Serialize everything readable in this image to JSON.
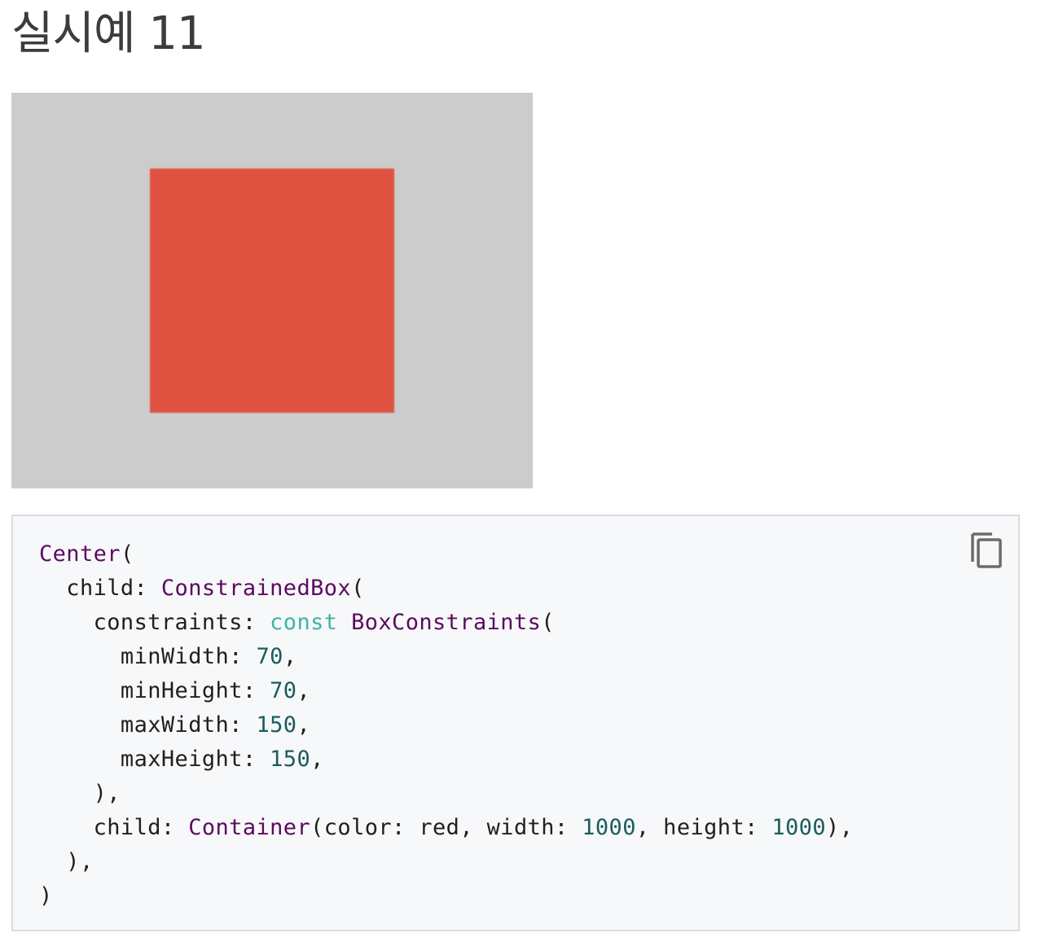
{
  "heading": "실시예 11",
  "colors": {
    "preview_background": "#cccccc",
    "box_color": "#e05340",
    "code_background": "#f7f8fa",
    "type_color": "#5b0b5e",
    "keyword_color": "#3fb4a5",
    "number_color": "#1a5d5d"
  },
  "copy_button": {
    "icon": "copy-icon"
  },
  "code": {
    "lines": [
      [
        {
          "t": "type",
          "v": "Center"
        },
        {
          "t": "plain",
          "v": "("
        }
      ],
      [
        {
          "t": "plain",
          "v": "  child: "
        },
        {
          "t": "type",
          "v": "ConstrainedBox"
        },
        {
          "t": "plain",
          "v": "("
        }
      ],
      [
        {
          "t": "plain",
          "v": "    constraints: "
        },
        {
          "t": "kw",
          "v": "const"
        },
        {
          "t": "plain",
          "v": " "
        },
        {
          "t": "type",
          "v": "BoxConstraints"
        },
        {
          "t": "plain",
          "v": "("
        }
      ],
      [
        {
          "t": "plain",
          "v": "      minWidth: "
        },
        {
          "t": "num",
          "v": "70"
        },
        {
          "t": "plain",
          "v": ","
        }
      ],
      [
        {
          "t": "plain",
          "v": "      minHeight: "
        },
        {
          "t": "num",
          "v": "70"
        },
        {
          "t": "plain",
          "v": ","
        }
      ],
      [
        {
          "t": "plain",
          "v": "      maxWidth: "
        },
        {
          "t": "num",
          "v": "150"
        },
        {
          "t": "plain",
          "v": ","
        }
      ],
      [
        {
          "t": "plain",
          "v": "      maxHeight: "
        },
        {
          "t": "num",
          "v": "150"
        },
        {
          "t": "plain",
          "v": ","
        }
      ],
      [
        {
          "t": "plain",
          "v": "    ),"
        }
      ],
      [
        {
          "t": "plain",
          "v": "    child: "
        },
        {
          "t": "type",
          "v": "Container"
        },
        {
          "t": "plain",
          "v": "(color: red, width: "
        },
        {
          "t": "num",
          "v": "1000"
        },
        {
          "t": "plain",
          "v": ", height: "
        },
        {
          "t": "num",
          "v": "1000"
        },
        {
          "t": "plain",
          "v": "),"
        }
      ],
      [
        {
          "t": "plain",
          "v": "  ),"
        }
      ],
      [
        {
          "t": "plain",
          "v": ")"
        }
      ]
    ]
  }
}
